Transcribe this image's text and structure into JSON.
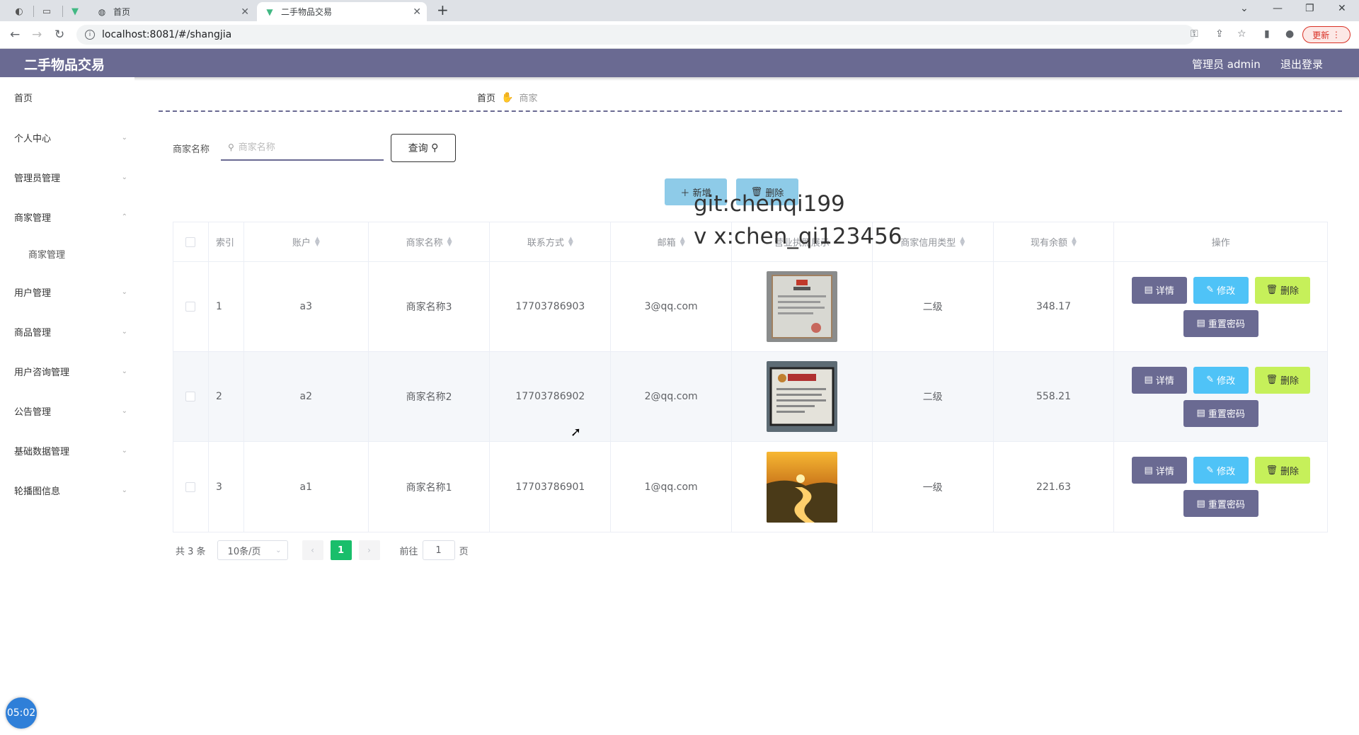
{
  "browser": {
    "tabs": [
      {
        "label": "首页",
        "icon": "globe-icon"
      },
      {
        "label": "二手物品交易",
        "icon": "vue-icon"
      }
    ],
    "url": "localhost:8081/#/shangjia",
    "update_label": "更新"
  },
  "header": {
    "title": "二手物品交易",
    "admin_label": "管理员 admin",
    "logout_label": "退出登录",
    "bg_color": "#6a6a92"
  },
  "sidebar": {
    "items": [
      {
        "label": "首页"
      },
      {
        "label": "个人中心"
      },
      {
        "label": "管理员管理"
      },
      {
        "label": "商家管理"
      },
      {
        "label": "商家管理"
      },
      {
        "label": "用户管理"
      },
      {
        "label": "商品管理"
      },
      {
        "label": "用户咨询管理"
      },
      {
        "label": "公告管理"
      },
      {
        "label": "基础数据管理"
      },
      {
        "label": "轮播图信息"
      }
    ]
  },
  "breadcrumb": {
    "home": "首页",
    "current": "商家"
  },
  "search": {
    "label": "商家名称",
    "placeholder": "商家名称",
    "button": "查询"
  },
  "actions": {
    "add": "新增",
    "delete": "删除"
  },
  "watermark": {
    "line1": "git:chenqi199",
    "line2": "v x:chen_qi123456"
  },
  "table": {
    "columns": [
      "索引",
      "账户",
      "商家名称",
      "联系方式",
      "邮箱",
      "营业执照展示",
      "商家信用类型",
      "现有余额",
      "操作"
    ],
    "rows": [
      {
        "index": "1",
        "account": "a3",
        "name": "商家名称3",
        "phone": "17703786903",
        "email": "3@qq.com",
        "credit": "二级",
        "balance": "348.17"
      },
      {
        "index": "2",
        "account": "a2",
        "name": "商家名称2",
        "phone": "17703786902",
        "email": "2@qq.com",
        "credit": "二级",
        "balance": "558.21"
      },
      {
        "index": "3",
        "account": "a1",
        "name": "商家名称1",
        "phone": "17703786901",
        "email": "1@qq.com",
        "credit": "一级",
        "balance": "221.63"
      }
    ],
    "row_buttons": {
      "detail": "详情",
      "edit": "修改",
      "delete": "删除",
      "reset": "重置密码"
    }
  },
  "pagination": {
    "total": "共 3 条",
    "page_size": "10条/页",
    "current_page": "1",
    "goto_label": "前往",
    "goto_value": "1",
    "page_suffix": "页"
  },
  "timer": "05:02"
}
